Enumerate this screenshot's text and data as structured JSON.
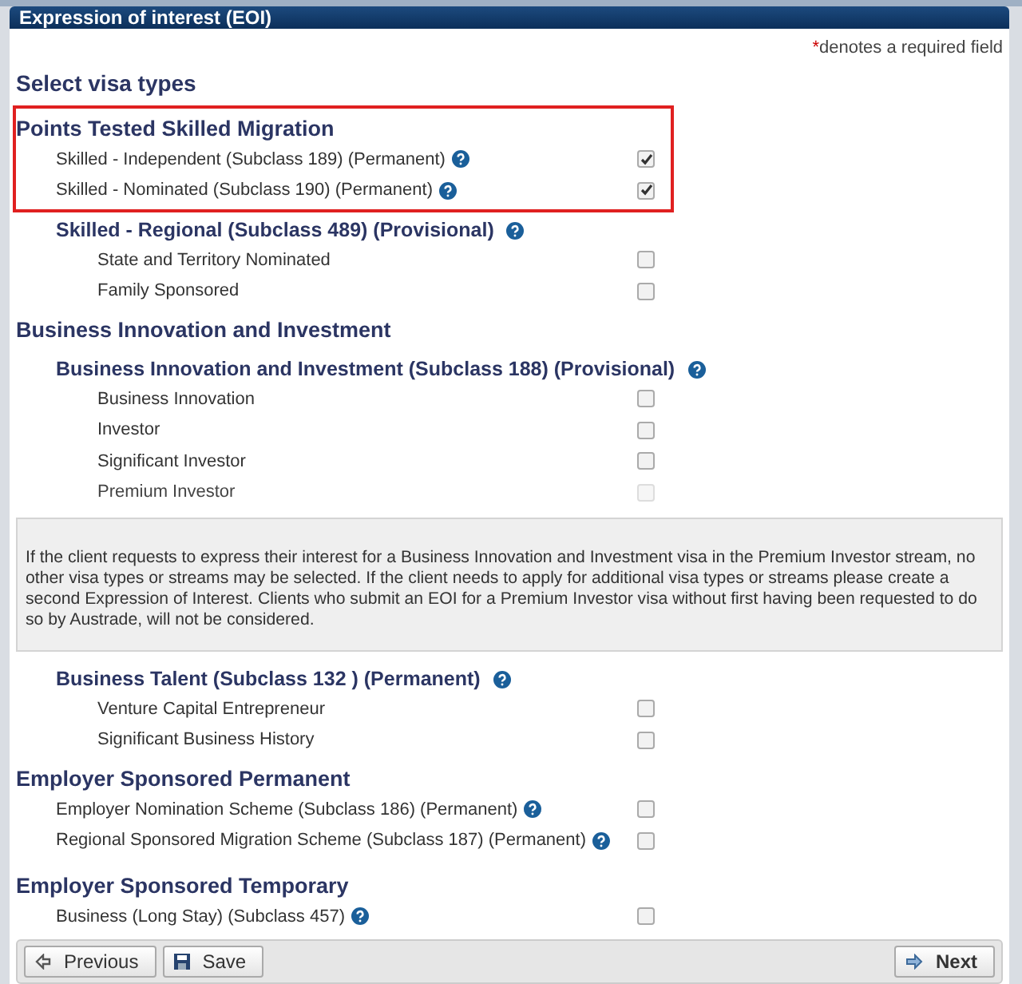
{
  "window": {
    "title": "Expression of interest (EOI)"
  },
  "required_note": {
    "mark": "*",
    "text": "denotes a required field"
  },
  "heading": "Select visa types",
  "sections": [
    {
      "title": "Points Tested Skilled Migration",
      "highlighted": true,
      "options": [
        {
          "label": "Skilled - Independent (Subclass 189) (Permanent)",
          "help": true,
          "checked": true,
          "disabled": false
        },
        {
          "label": "Skilled - Nominated (Subclass 190) (Permanent)",
          "help": true,
          "checked": true,
          "disabled": false
        }
      ],
      "subgroups": [
        {
          "title": "Skilled - Regional (Subclass 489) (Provisional)",
          "help": true,
          "options": [
            {
              "label": "State and Territory Nominated",
              "help": false,
              "checked": false,
              "disabled": false
            },
            {
              "label": "Family Sponsored",
              "help": false,
              "checked": false,
              "disabled": false
            }
          ]
        }
      ]
    },
    {
      "title": "Business Innovation and Investment",
      "highlighted": false,
      "subgroups": [
        {
          "title": "Business Innovation and Investment (Subclass 188) (Provisional)",
          "help": true,
          "options": [
            {
              "label": "Business Innovation",
              "help": false,
              "checked": false,
              "disabled": false
            },
            {
              "label": "Investor",
              "help": false,
              "checked": false,
              "disabled": false
            },
            {
              "label": "Significant Investor",
              "help": false,
              "checked": false,
              "disabled": false
            },
            {
              "label": "Premium Investor",
              "help": false,
              "checked": false,
              "disabled": true
            }
          ],
          "notice": "If the client requests to express their interest for a Business Innovation and Investment visa in the Premium Investor stream, no other visa types or streams may be selected. If the client needs to apply for additional visa types or streams please create a second Expression of Interest. Clients who submit an EOI for a Premium Investor visa without first having been requested to do so by Austrade, will not be considered."
        },
        {
          "title": "Business Talent (Subclass 132 ) (Permanent)",
          "help": true,
          "options": [
            {
              "label": "Venture Capital Entrepreneur",
              "help": false,
              "checked": false,
              "disabled": false
            },
            {
              "label": "Significant Business History",
              "help": false,
              "checked": false,
              "disabled": false
            }
          ]
        }
      ]
    },
    {
      "title": "Employer Sponsored Permanent",
      "highlighted": false,
      "options": [
        {
          "label": "Employer Nomination Scheme (Subclass 186) (Permanent)",
          "help": true,
          "checked": false,
          "disabled": false
        },
        {
          "label": "Regional Sponsored Migration Scheme (Subclass 187) (Permanent)",
          "help": true,
          "checked": false,
          "disabled": false
        }
      ]
    },
    {
      "title": "Employer Sponsored Temporary",
      "highlighted": false,
      "options": [
        {
          "label": "Business (Long Stay) (Subclass 457)",
          "help": true,
          "checked": false,
          "disabled": false
        }
      ]
    }
  ],
  "footer": {
    "buttons": [
      {
        "label": "Previous",
        "kind": "previous"
      },
      {
        "label": "Save",
        "kind": "save"
      },
      {
        "label": "Next",
        "kind": "next"
      }
    ]
  }
}
